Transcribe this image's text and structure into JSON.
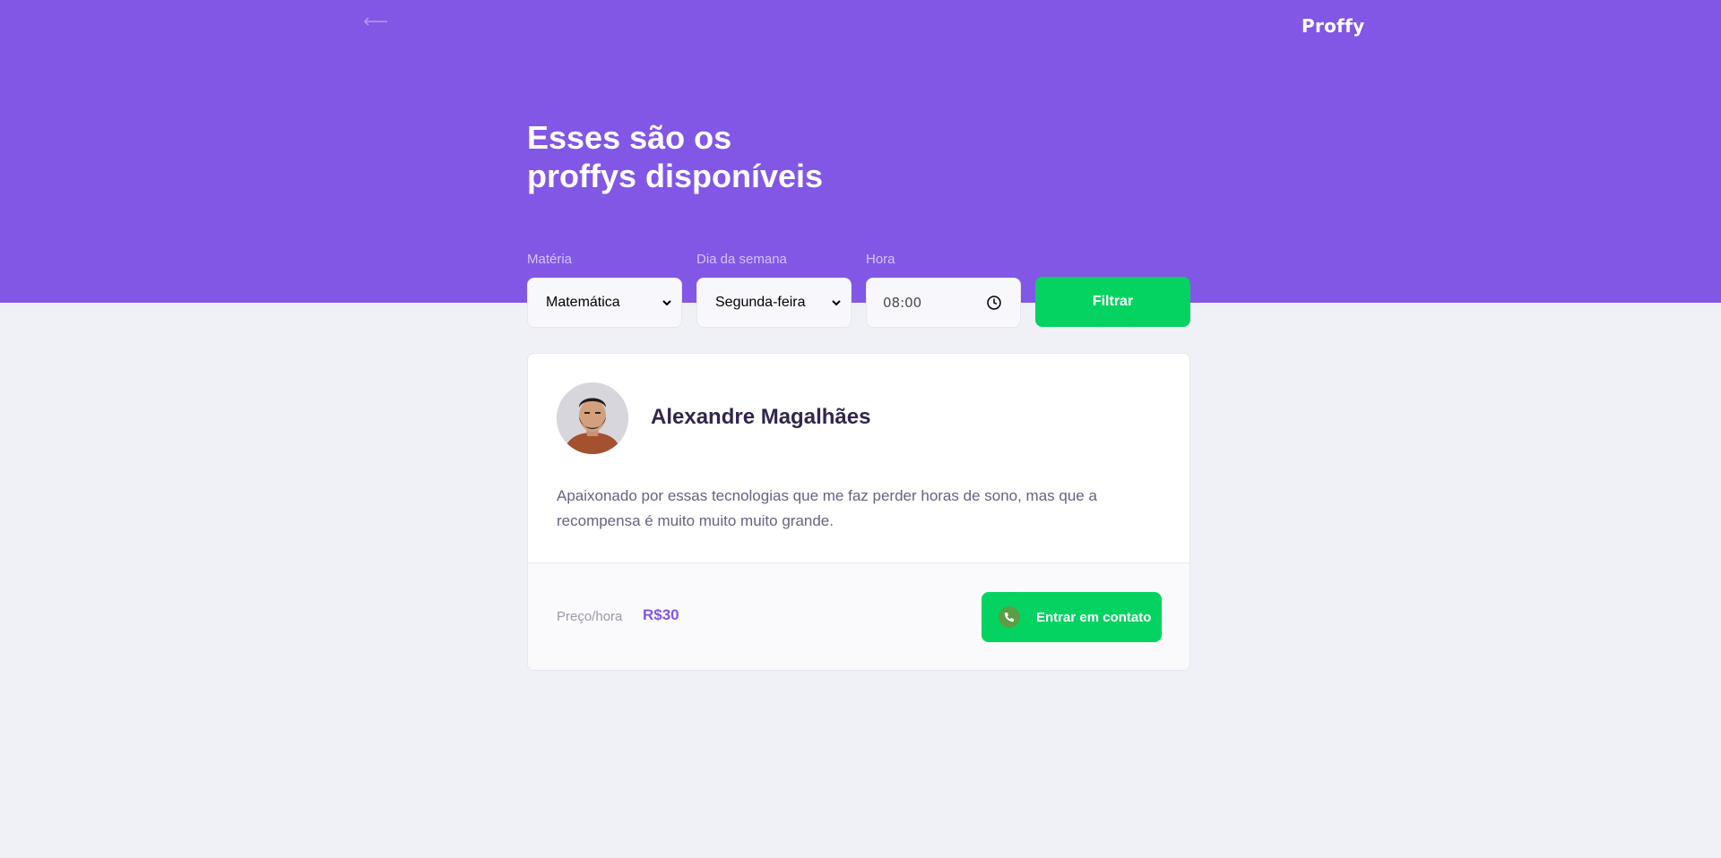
{
  "header": {
    "back_icon": "arrow-left-icon",
    "logo": "Proffy",
    "title_line1": "Esses são os",
    "title_line2": "proffys disponíveis"
  },
  "filters": {
    "subject": {
      "label": "Matéria",
      "value": "Matemática",
      "icon": "chevron-down-icon"
    },
    "week_day": {
      "label": "Dia da semana",
      "value": "Segunda-feira",
      "icon": "chevron-down-icon"
    },
    "time": {
      "label": "Hora",
      "value": "08:00",
      "icon": "clock-icon"
    },
    "submit_label": "Filtrar"
  },
  "teachers": [
    {
      "name": "Alexandre Magalhães",
      "bio": "Apaixonado por essas tecnologias que me faz perder horas de sono, mas que a recompensa é muito muito muito grande.",
      "price_label": "Preço/hora",
      "price": "R$30",
      "contact_label": "Entrar em contato",
      "contact_icon": "whatsapp-icon"
    }
  ],
  "colors": {
    "primary": "#8257E5",
    "secondary": "#04D361",
    "background": "#F0F0F7",
    "title_text": "#32264D",
    "body_text": "#6A6180"
  }
}
